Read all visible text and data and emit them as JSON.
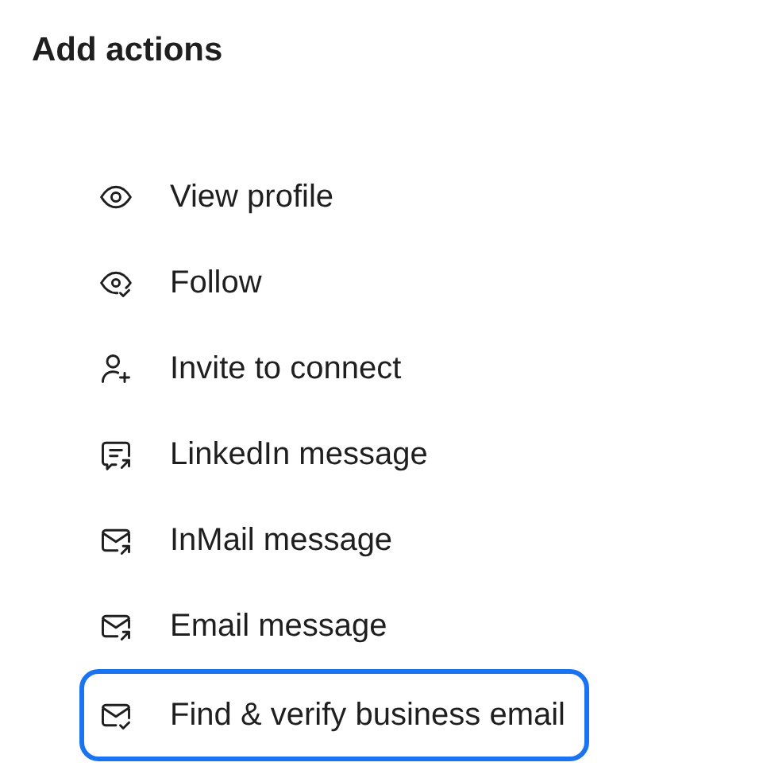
{
  "title": "Add actions",
  "actions": [
    {
      "label": "View profile",
      "selected": false
    },
    {
      "label": "Follow",
      "selected": false
    },
    {
      "label": "Invite to connect",
      "selected": false
    },
    {
      "label": "LinkedIn message",
      "selected": false
    },
    {
      "label": "InMail message",
      "selected": false
    },
    {
      "label": "Email message",
      "selected": false
    },
    {
      "label": "Find & verify business email",
      "selected": true
    }
  ]
}
